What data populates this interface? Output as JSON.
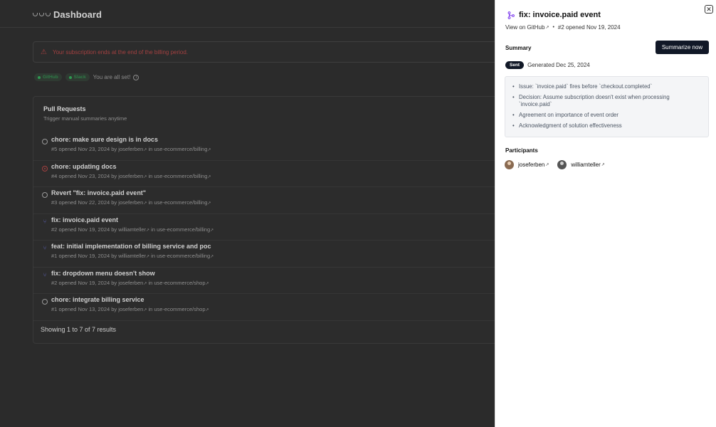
{
  "header": {
    "title": "Dashboard"
  },
  "alert": {
    "text": "Your subscription ends at the end of the billing period."
  },
  "integrations": [
    {
      "label": "GitHub"
    },
    {
      "label": "Slack"
    }
  ],
  "status_text": "You are all set!",
  "pull_requests": {
    "title": "Pull Requests",
    "subtitle": "Trigger manual summaries anytime",
    "items": [
      {
        "title": "chore: make sure design is in docs",
        "number": "#5",
        "opened": "opened Nov 23, 2024",
        "by": "by",
        "author": "josefer­ben",
        "in": "in",
        "repo": "use-ecommerce/billing",
        "state": "open"
      },
      {
        "title": "chore: updating docs",
        "number": "#4",
        "opened": "opened Nov 23, 2024",
        "by": "by",
        "author": "joseferben",
        "in": "in",
        "repo": "use-ecommerce/billing",
        "state": "closed"
      },
      {
        "title": "Revert \"fix: invoice.paid event\"",
        "number": "#3",
        "opened": "opened Nov 22, 2024",
        "by": "by",
        "author": "joseferben",
        "in": "in",
        "repo": "use-ecommerce/billing",
        "state": "open"
      },
      {
        "title": "fix: invoice.paid event",
        "number": "#2",
        "opened": "opened Nov 19, 2024",
        "by": "by",
        "author": "williamteller",
        "in": "in",
        "repo": "use-ecommerce/billing",
        "state": "merged"
      },
      {
        "title": "feat: initial implementation of billing service and poc",
        "number": "#1",
        "opened": "opened Nov 19, 2024",
        "by": "by",
        "author": "williamteller",
        "in": "in",
        "repo": "use-ecommerce/billing",
        "state": "merged"
      },
      {
        "title": "fix: dropdown menu doesn't show",
        "number": "#2",
        "opened": "opened Nov 19, 2024",
        "by": "by",
        "author": "joseferben",
        "in": "in",
        "repo": "use-ecommerce/shop",
        "state": "merged"
      },
      {
        "title": "chore: integrate billing service",
        "number": "#1",
        "opened": "opened Nov 13, 2024",
        "by": "by",
        "author": "joseferben",
        "in": "in",
        "repo": "use-ecommerce/shop",
        "state": "open"
      }
    ],
    "footer": "Showing 1 to 7 of 7 results"
  },
  "panel": {
    "title": "fix: invoice.paid event",
    "view_link": "View on GitHub",
    "meta": "#2 opened Nov 19, 2024",
    "summary_heading": "Summary",
    "summarize_button": "Summarize now",
    "sent_badge": "Sent",
    "generated": "Generated Dec 25, 2024",
    "summary_items": [
      "Issue: `invoice.paid` fires before `checkout.completed`",
      "Decision: Assume subscription doesn't exist when processing `invoice.paid`",
      "Agreement on importance of event order",
      "Acknowledgment of solution effectiveness"
    ],
    "participants_heading": "Participants",
    "participants": [
      {
        "name": "joseferben"
      },
      {
        "name": "williamteller"
      }
    ]
  }
}
